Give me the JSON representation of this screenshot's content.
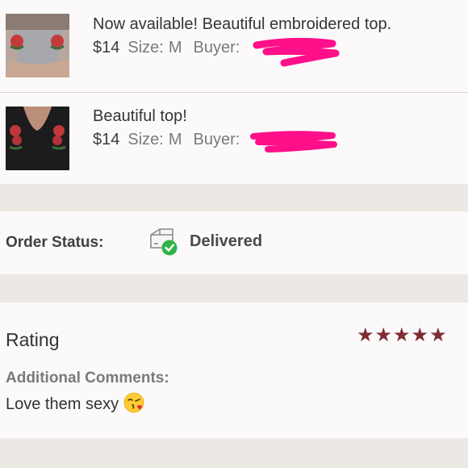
{
  "order": {
    "items": [
      {
        "title": "Now available! Beautiful embroidered top.",
        "price": "$14",
        "size_label": "Size:",
        "size": "M",
        "buyer_label": "Buyer:"
      },
      {
        "title": "Beautiful top!",
        "price": "$14",
        "size_label": "Size:",
        "size": "M",
        "buyer_label": "Buyer:"
      }
    ]
  },
  "status": {
    "label": "Order Status:",
    "value": "Delivered",
    "icon": "package-delivered-icon"
  },
  "rating": {
    "label": "Rating",
    "stars": 5,
    "stars_text": "★★★★★",
    "star_color": "#7f2c35",
    "comments_label": "Additional Comments:",
    "comment": "Love them sexy",
    "comment_emoji": "kiss-emoji"
  },
  "colors": {
    "redaction": "#ff0f8a",
    "delivered_check": "#2fb34a",
    "background": "#ece9e4",
    "card": "#fbf9fa"
  }
}
